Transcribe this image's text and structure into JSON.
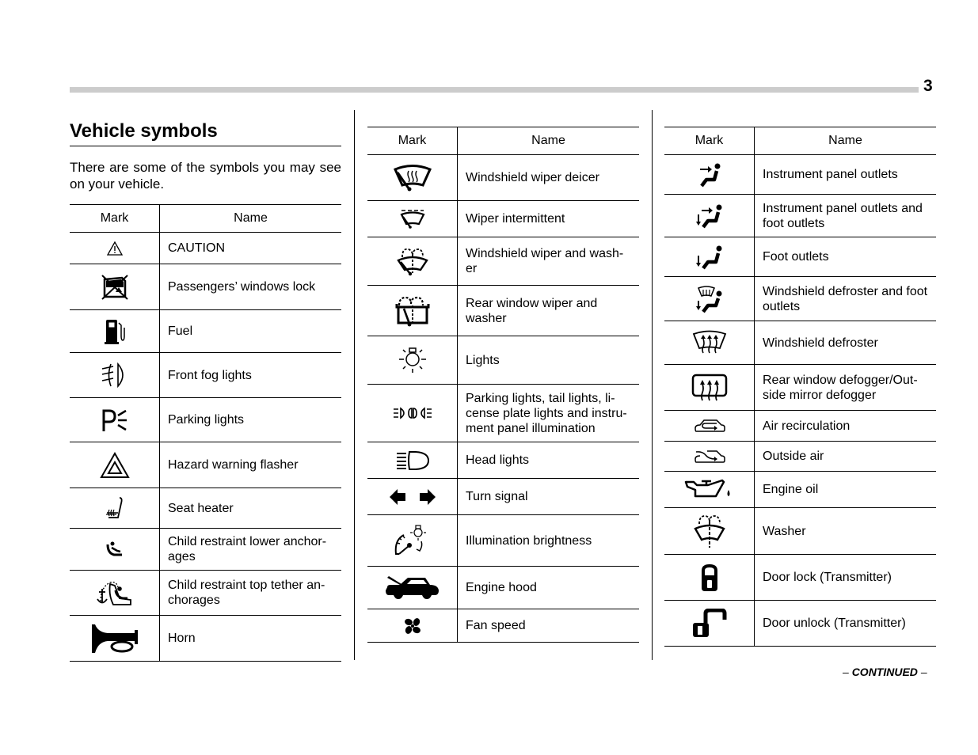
{
  "page": {
    "number": "3",
    "title": "Vehicle symbols",
    "intro": "There are some of the symbols you may see on your vehicle.",
    "continued": "CONTINUED",
    "dash": "–"
  },
  "table_headers": {
    "mark": "Mark",
    "name": "Name"
  },
  "columns": [
    {
      "rows": [
        {
          "icon": "caution-icon",
          "name": "CAUTION"
        },
        {
          "icon": "passengers-windows-lock-icon",
          "name": "Passengers’ windows lock"
        },
        {
          "icon": "fuel-icon",
          "name": "Fuel"
        },
        {
          "icon": "front-fog-lights-icon",
          "name": "Front fog lights"
        },
        {
          "icon": "parking-lights-icon",
          "name": "Parking lights"
        },
        {
          "icon": "hazard-warning-flasher-icon",
          "name": "Hazard warning flasher"
        },
        {
          "icon": "seat-heater-icon",
          "name": "Seat heater"
        },
        {
          "icon": "child-restraint-lower-anchorages-icon",
          "name": "Child restraint lower anchor-ages"
        },
        {
          "icon": "child-restraint-top-tether-icon",
          "name": "Child restraint top tether an-chorages"
        },
        {
          "icon": "horn-icon",
          "name": "Horn"
        }
      ]
    },
    {
      "rows": [
        {
          "icon": "windshield-wiper-deicer-icon",
          "name": "Windshield wiper deicer"
        },
        {
          "icon": "wiper-intermittent-icon",
          "name": "Wiper intermittent"
        },
        {
          "icon": "windshield-wiper-washer-icon",
          "name": "Windshield wiper and wash-er"
        },
        {
          "icon": "rear-window-wiper-washer-icon",
          "name": "Rear window wiper and washer"
        },
        {
          "icon": "lights-icon",
          "name": "Lights"
        },
        {
          "icon": "parking-tail-lights-icon",
          "name": "Parking lights, tail lights, li-cense plate lights and instru-ment panel illumination"
        },
        {
          "icon": "head-lights-icon",
          "name": "Head lights"
        },
        {
          "icon": "turn-signal-icon",
          "name": "Turn signal"
        },
        {
          "icon": "illumination-brightness-icon",
          "name": "Illumination brightness"
        },
        {
          "icon": "engine-hood-icon",
          "name": "Engine hood"
        },
        {
          "icon": "fan-speed-icon",
          "name": "Fan speed"
        }
      ]
    },
    {
      "rows": [
        {
          "icon": "instrument-panel-outlets-icon",
          "name": "Instrument panel outlets"
        },
        {
          "icon": "panel-and-foot-outlets-icon",
          "name": "Instrument panel outlets and foot outlets"
        },
        {
          "icon": "foot-outlets-icon",
          "name": "Foot outlets"
        },
        {
          "icon": "defroster-and-foot-outlets-icon",
          "name": "Windshield defroster and foot outlets"
        },
        {
          "icon": "windshield-defroster-icon",
          "name": "Windshield defroster"
        },
        {
          "icon": "rear-window-defogger-icon",
          "name": "Rear window defogger/Out-side mirror defogger"
        },
        {
          "icon": "air-recirculation-icon",
          "name": "Air recirculation"
        },
        {
          "icon": "outside-air-icon",
          "name": "Outside air"
        },
        {
          "icon": "engine-oil-icon",
          "name": "Engine oil"
        },
        {
          "icon": "washer-icon",
          "name": "Washer"
        },
        {
          "icon": "door-lock-icon",
          "name": "Door lock (Transmitter)"
        },
        {
          "icon": "door-unlock-icon",
          "name": "Door unlock (Transmitter)"
        }
      ]
    }
  ]
}
